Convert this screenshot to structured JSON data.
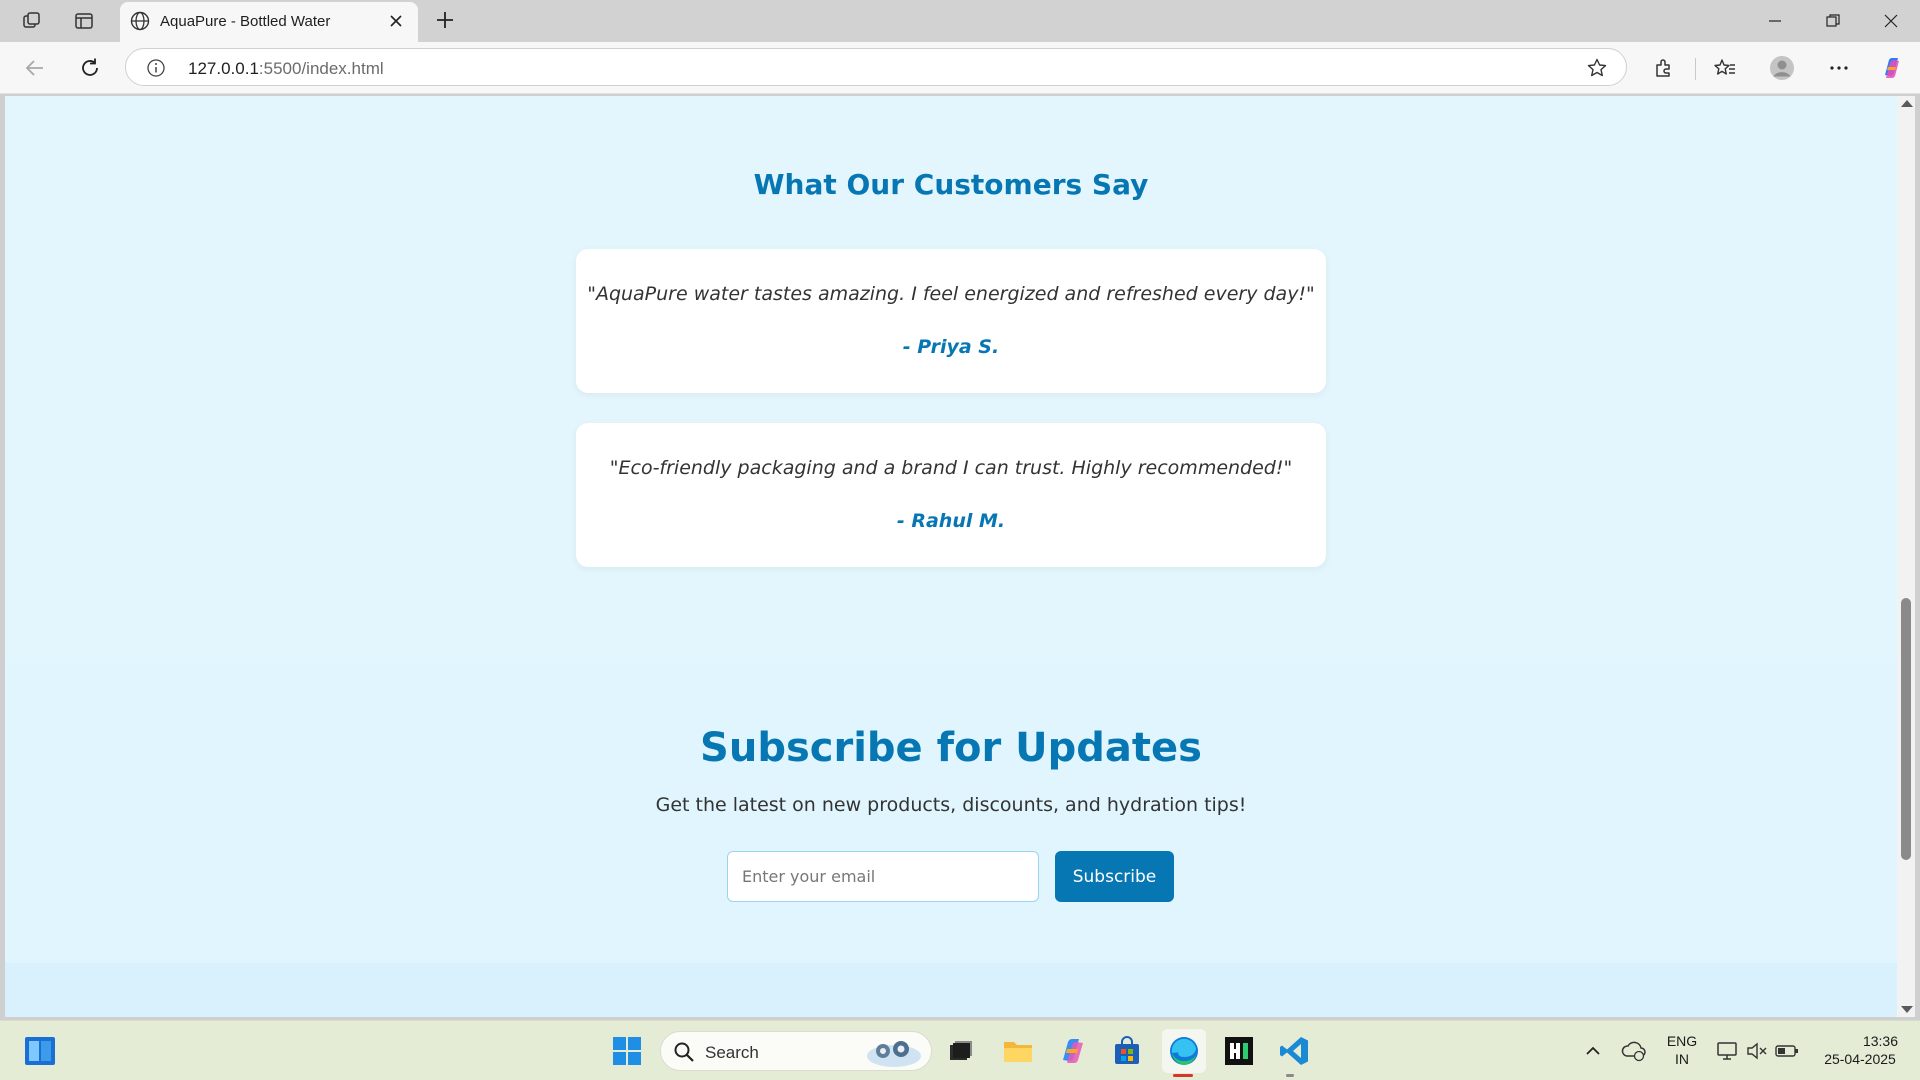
{
  "browser": {
    "tab_title": "AquaPure - Bottled Water",
    "url_host": "127.0.0.1",
    "url_rest": ":5500/index.html"
  },
  "testimonials": {
    "title": "What Our Customers Say",
    "items": [
      {
        "quote": "\"AquaPure water tastes amazing. I feel energized and refreshed every day!\"",
        "author": "- Priya S."
      },
      {
        "quote": "\"Eco-friendly packaging and a brand I can trust. Highly recommended!\"",
        "author": "- Rahul M."
      }
    ]
  },
  "subscribe": {
    "title": "Subscribe for Updates",
    "subtitle": "Get the latest on new products, discounts, and hydration tips!",
    "email_placeholder": "Enter your email",
    "button_label": "Subscribe"
  },
  "taskbar": {
    "search_label": "Search",
    "language_top": "ENG",
    "language_bottom": "IN",
    "time": "13:36",
    "date": "25-04-2025"
  },
  "colors": {
    "brand": "#0777b4",
    "page_bg": "#e3f6fd",
    "card_bg": "#ffffff"
  }
}
